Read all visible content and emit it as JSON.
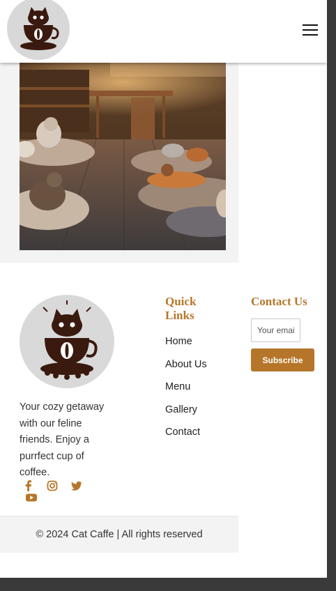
{
  "header": {
    "logo_icon": "cat-in-coffee-cup-logo",
    "menu_icon": "hamburger-menu-icon"
  },
  "hero": {
    "image": "cat-cafe-interior-photo"
  },
  "footer": {
    "logo_icon": "cat-in-coffee-cup-logo",
    "tagline": "Your cozy getaway with our feline friends. Enjoy a purrfect cup of coffee.",
    "social_icons": [
      "facebook-icon",
      "instagram-icon",
      "twitter-icon",
      "youtube-icon"
    ],
    "quick_links": {
      "title": "Quick Links",
      "items": [
        "Home",
        "About Us",
        "Menu",
        "Gallery",
        "Contact"
      ]
    },
    "contact": {
      "title": "Contact Us",
      "email_placeholder": "Your email",
      "subscribe_label": "Subscribe"
    },
    "copyright": "© 2024 Cat Caffe | All rights reserved"
  },
  "colors": {
    "accent": "#b5762a",
    "page_bg": "#ffffff",
    "section_bg": "#f3f3f3",
    "scrollbar": "#3a3a3a"
  }
}
